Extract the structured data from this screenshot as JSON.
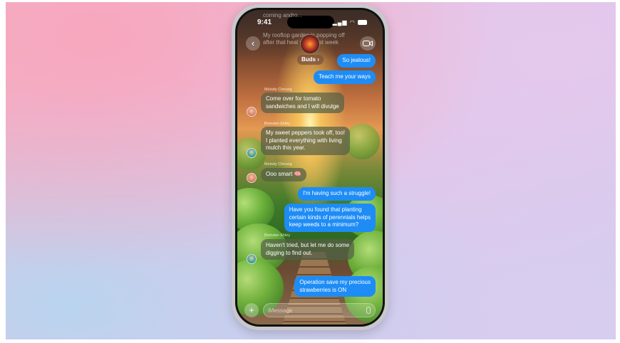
{
  "status_bar": {
    "time": "9:41",
    "signal": "▂▄▆",
    "wifi": "◠"
  },
  "header": {
    "faded_top": "coming andro...",
    "faded_msg": "My rooftop garden is popping off\nafter that heat wave last week",
    "group_name": "Buds",
    "chevron": "›",
    "back_icon": "‹"
  },
  "messages": [
    {
      "dir": "out",
      "text": "So jealous!"
    },
    {
      "dir": "out",
      "text": "Teach me your ways"
    },
    {
      "dir": "in",
      "sender": "Melody Cheung",
      "text": "Come over for tomato\nsandwiches and I will divulge"
    },
    {
      "dir": "in",
      "sender": "Brendan Ehley",
      "text": "My sweet peppers took off, too!\nI planted everything with living\nmulch this year."
    },
    {
      "dir": "in",
      "sender": "Melody Cheung",
      "text": "Ooo smart 🧠"
    },
    {
      "dir": "out",
      "text": "I'm having such a struggle!"
    },
    {
      "dir": "out",
      "text": "Have you found that planting\ncertain kinds of perennials helps\nkeep weeds to a minimum?"
    },
    {
      "dir": "in",
      "sender": "Brendan Ehley",
      "text": "Haven't tried, but let me do some\ndigging to find out."
    },
    {
      "dir": "out",
      "text": "Operation save my precious\nstrawberries is ON"
    }
  ],
  "compose": {
    "plus": "+",
    "placeholder": "iMessage"
  },
  "colors": {
    "outgoing": "#1e8cf5",
    "incoming": "rgba(85,95,70,0.72)"
  }
}
